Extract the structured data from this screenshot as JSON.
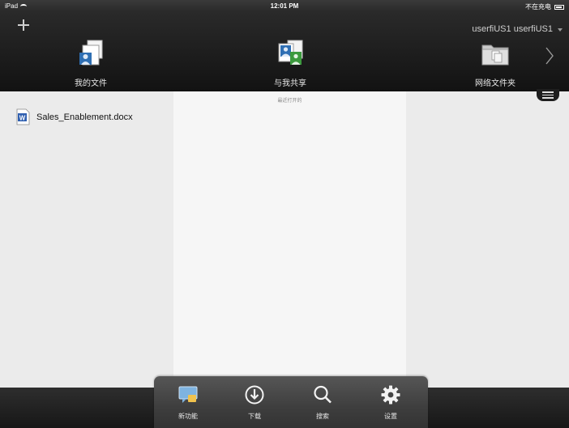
{
  "status_bar": {
    "device": "iPad",
    "time": "12:01 PM",
    "charging": "不在充电"
  },
  "header": {
    "user": "userfiUS1 userfiUS1",
    "nav": [
      {
        "label": "我的文件",
        "icon": "my-files-icon"
      },
      {
        "label": "与我共享",
        "icon": "shared-with-me-icon"
      },
      {
        "label": "网络文件夹",
        "icon": "network-folder-icon"
      }
    ]
  },
  "recent": {
    "label": "最近打开的"
  },
  "files": [
    {
      "name": "Sales_Enablement.docx",
      "icon": "word-document-icon"
    }
  ],
  "toolbar": [
    {
      "label": "新功能",
      "icon": "whats-new-icon"
    },
    {
      "label": "下载",
      "icon": "download-icon"
    },
    {
      "label": "搜索",
      "icon": "search-icon"
    },
    {
      "label": "设置",
      "icon": "settings-gear-icon"
    }
  ],
  "colors": {
    "header_bg": "#1f1f1f",
    "panel_side": "#ebebeb",
    "panel_center": "#f6f6f6",
    "word_blue": "#2f5fb0"
  }
}
